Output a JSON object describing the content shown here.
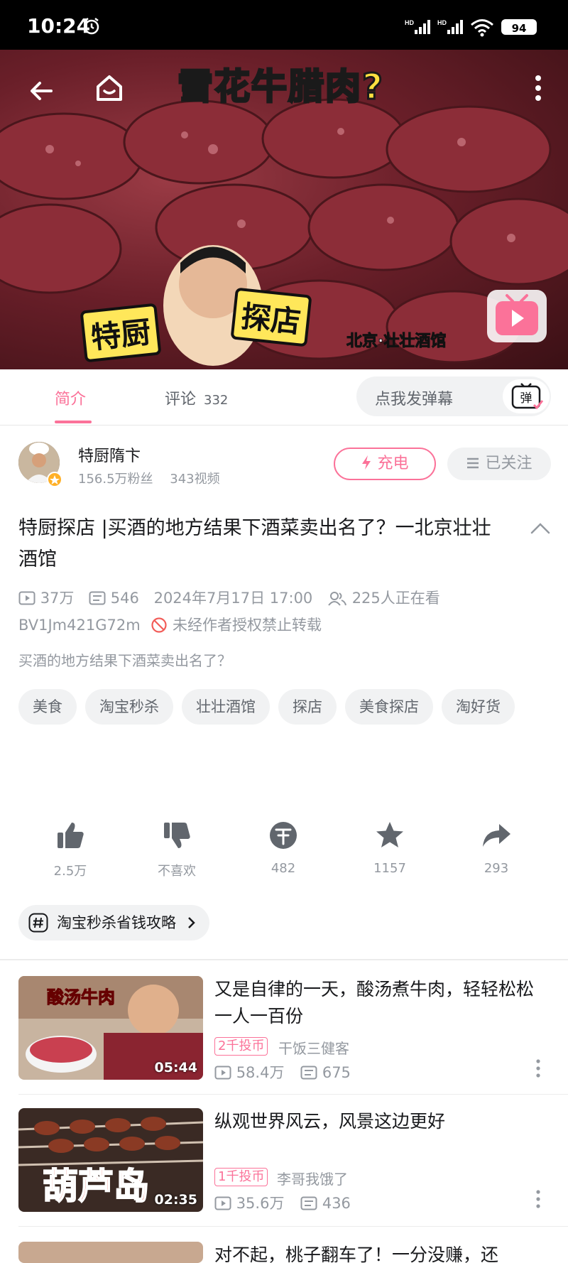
{
  "status_bar": {
    "time": "10:24",
    "battery": "94"
  },
  "video": {
    "overlay_title": "雪花牛腊肉?",
    "sticker_left": "特厨",
    "sticker_right": "探店",
    "location": "北京·壮壮酒馆"
  },
  "tabs": {
    "intro": "简介",
    "comments": "评论",
    "comments_count": "332"
  },
  "danmaku": {
    "placeholder": "点我发弹幕",
    "button": "弹"
  },
  "uploader": {
    "name": "特厨隋卞",
    "fans": "156.5万粉丝",
    "videos": "343视频",
    "charge": "充电",
    "followed": "已关注"
  },
  "video_info": {
    "title": "特厨探店 |买酒的地方结果下酒菜卖出名了？一北京壮壮酒馆",
    "views": "37万",
    "danmaku_count": "546",
    "publish_time": "2024年7月17日 17:00",
    "watching": "225人正在看",
    "bvid": "BV1Jm421G72m",
    "notice": "未经作者授权禁止转载",
    "description": "买酒的地方结果下酒菜卖出名了？"
  },
  "tags": [
    "美食",
    "淘宝秒杀",
    "壮壮酒馆",
    "探店",
    "美食探店",
    "淘好货"
  ],
  "actions": {
    "like": "2.5万",
    "dislike": "不喜欢",
    "coin": "482",
    "favorite": "1157",
    "share": "293"
  },
  "promo": {
    "label": "淘宝秒杀省钱攻略"
  },
  "recommendations": [
    {
      "thumb_label": "酸汤牛肉",
      "duration": "05:44",
      "title": "又是自律的一天，酸汤煮牛肉，轻轻松松一人一百份",
      "coin_badge": "2千投币",
      "author": "干饭三健客",
      "views": "58.4万",
      "danmaku": "675"
    },
    {
      "thumb_label": "葫芦岛",
      "duration": "02:35",
      "title": "纵观世界风云，风景这边更好",
      "coin_badge": "1千投币",
      "author": "李哥我饿了",
      "views": "35.6万",
      "danmaku": "436"
    },
    {
      "title": "对不起，桃子翻车了！一分没赚，还"
    }
  ],
  "colors": {
    "accent": "#fb7299",
    "muted": "#9499a0",
    "chip_bg": "#f1f2f3"
  }
}
